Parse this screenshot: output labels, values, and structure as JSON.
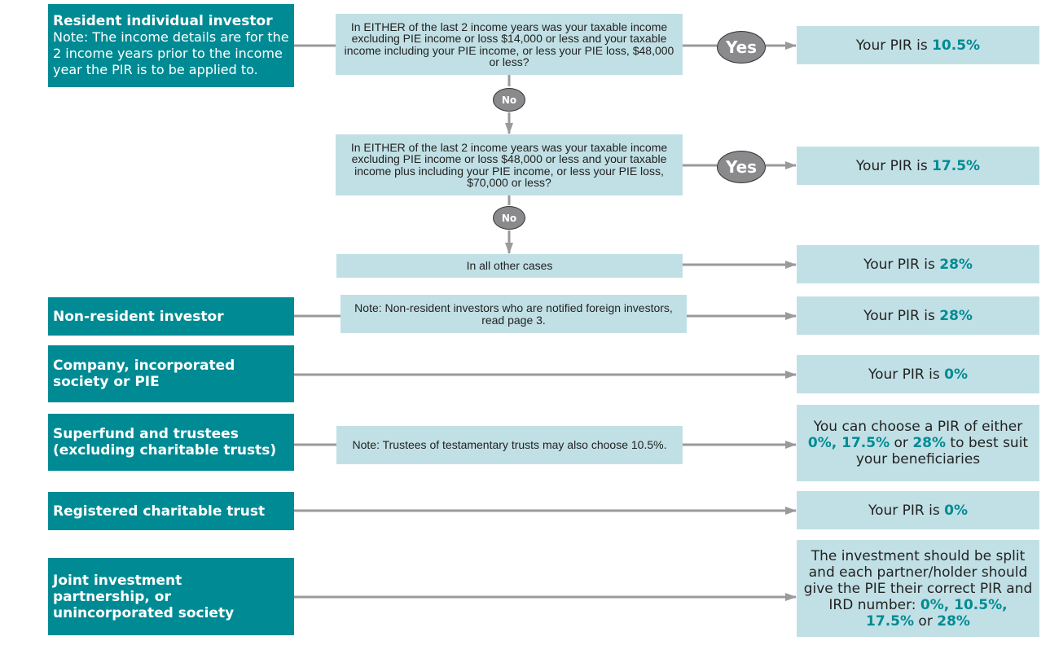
{
  "colors": {
    "teal": "#008b94",
    "light_box": "#c1e0e5",
    "connector": "#9a9a9c",
    "oval": "#8a8a8d"
  },
  "investors": [
    {
      "title": "Resident individual investor",
      "note": "Note: The income details are for the 2 income years prior to the income year the PIR is to be applied to."
    },
    {
      "title": "Non-resident investor"
    },
    {
      "title": "Company, incorporated society or PIE"
    },
    {
      "title": "Superfund and trustees (excluding charitable trusts)"
    },
    {
      "title": "Registered charitable trust"
    },
    {
      "title": "Joint investment partnership, or unincorporated society"
    }
  ],
  "questions": {
    "q1": "In EITHER of the last 2 income years was your taxable income excluding PIE income or loss $14,000 or less and your taxable income including your PIE income, or less your PIE loss, $48,000 or less?",
    "q2": "In EITHER of the last 2 income years was your taxable income excluding PIE income or loss $48,000 or less and your taxable income plus including your PIE income, or less your PIE loss, $70,000 or less?",
    "other": "In all other cases",
    "nonresident_note": "Note: Non-resident investors who are notified foreign investors, read page 3.",
    "trustee_note": "Note: Trustees of testamentary trusts may also choose 10.5%."
  },
  "decisions": {
    "yes": "Yes",
    "no": "No"
  },
  "results": {
    "prefix": "Your PIR is",
    "r1": "10.5%",
    "r2": "17.5%",
    "r3": "28%",
    "r4": "28%",
    "r5": "0%",
    "choose": {
      "t1": "You can choose a PIR of either",
      "v1": "0%, 17.5%",
      "t2": " or ",
      "v2": "28%",
      "t3": " to best suit your beneficiaries"
    },
    "r7": "0%",
    "joint": {
      "t1": "The investment should be split and each partner/holder should give the PIE their correct PIR and IRD number: ",
      "v1": "0%, 10.5%, 17.5%",
      "t2": " or ",
      "v2": "28%"
    }
  }
}
